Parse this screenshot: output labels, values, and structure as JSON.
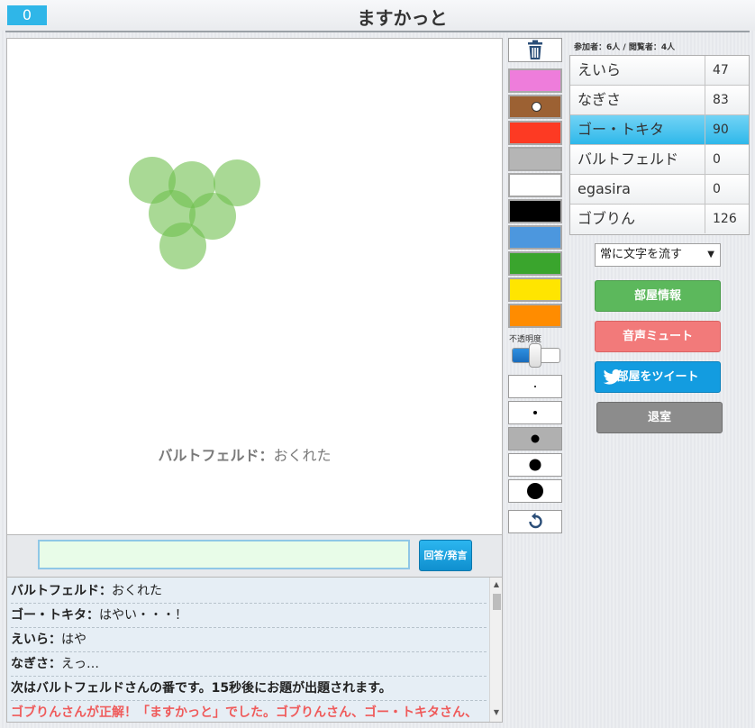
{
  "header": {
    "timer": "0",
    "room_title": "ますかっと"
  },
  "canvas": {
    "message_name": "バルトフェルド：",
    "message_text": "おくれた",
    "drawing": {
      "circle_color": "#6fbf4f",
      "circle_opacity": 0.6
    }
  },
  "answer": {
    "input_value": "",
    "button_label": "回答/発言"
  },
  "chat": {
    "lines": [
      {
        "who": "バルトフェルド：",
        "text": "おくれた"
      },
      {
        "who": "ゴー・トキタ：",
        "text": "はやい・・・！"
      },
      {
        "who": "えいら：",
        "text": "はや"
      },
      {
        "who": "なぎさ：",
        "text": "えっ…"
      }
    ],
    "system_line": "次はバルトフェルドさんの番です。15秒後にお題が出題されます。",
    "correct_line": "ゴブりんさんが正解！「ますかっと」でした。ゴブりんさん、ゴー・トキタさん、"
  },
  "tools": {
    "trash_icon": "trash-icon",
    "palette": [
      "#ee7ddb",
      "#9c6133",
      "#fd3a23",
      "#b5b5b5",
      "#ffffff",
      "#000000",
      "#4c97de",
      "#3aa52d",
      "#ffe500",
      "#ff8c00"
    ],
    "selected_color_index": 1,
    "opacity_label": "不透明度",
    "opacity_value": 0.5,
    "sizes": [
      "xs",
      "s",
      "m",
      "l",
      "xl"
    ],
    "selected_size_index": 2,
    "undo_icon": "undo-icon"
  },
  "side": {
    "participants_text": "参加者：6人 / 閲覧者：4人",
    "players": [
      {
        "name": "えいら",
        "score": "47"
      },
      {
        "name": "なぎさ",
        "score": "83"
      },
      {
        "name": "ゴー・トキタ",
        "score": "90",
        "active": true
      },
      {
        "name": "バルトフェルド",
        "score": "0"
      },
      {
        "name": "egasira",
        "score": "0"
      },
      {
        "name": "ゴブりん",
        "score": "126"
      }
    ],
    "mode_select": "常に文字を流す",
    "btn_room_info": "部屋情報",
    "btn_mute": "音声ミュート",
    "btn_tweet": "部屋をツイート",
    "btn_exit": "退室"
  }
}
